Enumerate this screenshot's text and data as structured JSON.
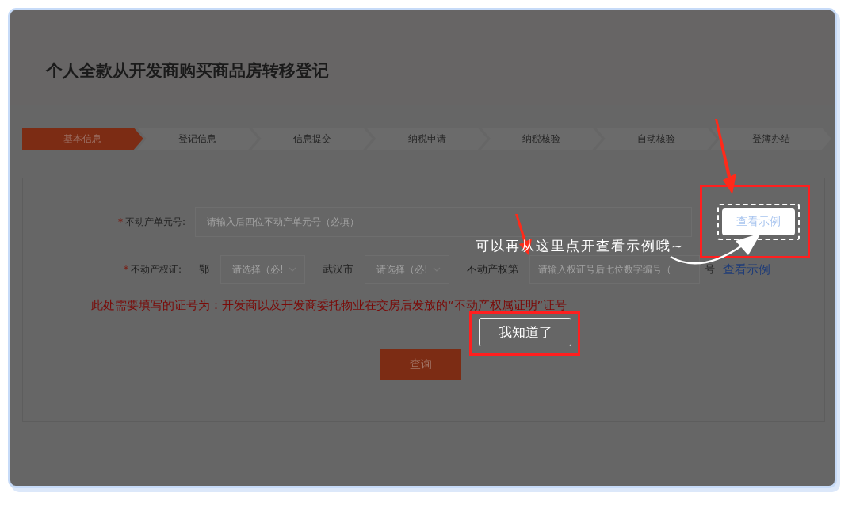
{
  "title": "个人全款从开发商购买商品房转移登记",
  "steps": [
    {
      "label": "基本信息",
      "selected": true
    },
    {
      "label": "登记信息",
      "selected": false
    },
    {
      "label": "信息提交",
      "selected": false
    },
    {
      "label": "纳税申请",
      "selected": false
    },
    {
      "label": "纳税核验",
      "selected": false
    },
    {
      "label": "自动核验",
      "selected": false
    },
    {
      "label": "登簿办结",
      "selected": false
    }
  ],
  "form": {
    "unit_row": {
      "required_mark": "*",
      "label": "不动产单元号:",
      "placeholder": "请输入后四位不动产单元号（必填）",
      "example_button": "查看示例"
    },
    "cert_row": {
      "required_mark": "*",
      "label": "不动产权证:",
      "prefix": "鄂",
      "province_select": {
        "placeholder": "请选择（必!"
      },
      "city_label": "武汉市",
      "city_select": {
        "placeholder": "请选择（必!"
      },
      "number_label": "不动产权第",
      "number_field": {
        "placeholder": "请输入权证号后七位数字编号（"
      },
      "suffix": "号",
      "example_link": "查看示例"
    },
    "notice": "此处需要填写的证号为：开发商以及开发商委托物业在交房后发放的“不动产权属证明”证号",
    "query_button": "查询"
  },
  "guide": {
    "message": "可以再从这里点开查看示例哦~",
    "dismiss_button": "我知道了"
  }
}
